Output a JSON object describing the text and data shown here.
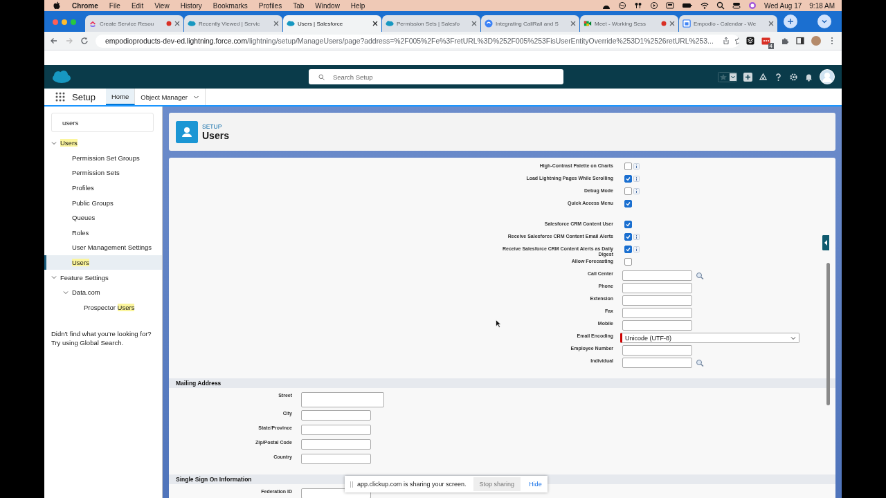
{
  "menu_bar": {
    "app": "Chrome",
    "items": [
      "File",
      "Edit",
      "View",
      "History",
      "Bookmarks",
      "Profiles",
      "Tab",
      "Window",
      "Help"
    ],
    "date": "Wed Aug 17",
    "time": "9:18 AM"
  },
  "tabs": [
    {
      "title": "Create Service Resou",
      "kind": "clickup",
      "recording": true,
      "selected": false
    },
    {
      "title": "Recently Viewed | Servic",
      "kind": "cloud",
      "recording": false,
      "selected": false
    },
    {
      "title": "Users | Salesforce",
      "kind": "cloud",
      "recording": false,
      "selected": true
    },
    {
      "title": "Permission Sets | Salesfo",
      "kind": "cloud",
      "recording": false,
      "selected": false
    },
    {
      "title": "Integrating CallRail and S",
      "kind": "callrail",
      "recording": false,
      "selected": false
    },
    {
      "title": "Meet - Working Sess",
      "kind": "meet",
      "recording": true,
      "selected": false
    },
    {
      "title": "Empodio - Calendar - We",
      "kind": "calendar",
      "recording": false,
      "selected": false
    }
  ],
  "address_bar": {
    "host": "empodioproducts-dev-ed.lightning.force.com",
    "path": "/lightning/setup/ManageUsers/page?address=%2F005%2Fe%3FretURL%3D%252F005%253FisUserEntityOverride%253D1%2526retURL%253...",
    "extension_badge": "4"
  },
  "header": {
    "search": {
      "placeholder": "Search Setup"
    }
  },
  "nav": {
    "app_name": "Setup",
    "tabs": [
      {
        "label": "Home",
        "selected": true,
        "dropdown": false
      },
      {
        "label": "Object Manager",
        "selected": false,
        "dropdown": true
      }
    ]
  },
  "sidebar": {
    "search": {
      "value": "users"
    },
    "tree": [
      {
        "segments": [
          {
            "text": "Users",
            "highlight": true
          }
        ],
        "expanded": true,
        "selected": false,
        "children": [
          {
            "segments": [
              {
                "text": "Permission Set Groups",
                "highlight": false
              }
            ],
            "selected": false
          },
          {
            "segments": [
              {
                "text": "Permission Sets",
                "highlight": false
              }
            ],
            "selected": false
          },
          {
            "segments": [
              {
                "text": "Profiles",
                "highlight": false
              }
            ],
            "selected": false
          },
          {
            "segments": [
              {
                "text": "Public Groups",
                "highlight": false
              }
            ],
            "selected": false
          },
          {
            "segments": [
              {
                "text": "Queues",
                "highlight": false
              }
            ],
            "selected": false
          },
          {
            "segments": [
              {
                "text": "Roles",
                "highlight": false
              }
            ],
            "selected": false
          },
          {
            "segments": [
              {
                "text": "User Management Settings",
                "highlight": false
              }
            ],
            "selected": false
          },
          {
            "segments": [
              {
                "text": "Users",
                "highlight": true
              }
            ],
            "selected": true
          }
        ]
      },
      {
        "segments": [
          {
            "text": "Feature Settings",
            "highlight": false
          }
        ],
        "expanded": true,
        "selected": false,
        "children": [
          {
            "segments": [
              {
                "text": "Data.com",
                "highlight": false
              }
            ],
            "expanded": true,
            "selected": false,
            "children": [
              {
                "segments": [
                  {
                    "text": "Prospector ",
                    "highlight": false
                  },
                  {
                    "text": "Users",
                    "highlight": true
                  }
                ],
                "selected": false
              }
            ]
          }
        ]
      }
    ],
    "footer": "Didn't find what you're looking for? Try using Global Search."
  },
  "page_header": {
    "eyebrow": "SETUP",
    "title": "Users"
  },
  "form": {
    "groups": [
      {
        "rows": [
          {
            "label": "High-Contrast Palette on Charts",
            "kind": "checkbox",
            "checked": false,
            "info": true
          },
          {
            "label": "Load Lightning Pages While Scrolling",
            "kind": "checkbox",
            "checked": true,
            "info": true
          },
          {
            "label": "Debug Mode",
            "kind": "checkbox",
            "checked": false,
            "info": true
          },
          {
            "label": "Quick Access Menu",
            "kind": "checkbox",
            "checked": true,
            "info": false
          }
        ]
      },
      {
        "rows": [
          {
            "label": "Salesforce CRM Content User",
            "kind": "checkbox",
            "checked": true,
            "info": false
          },
          {
            "label": "Receive Salesforce CRM Content Email Alerts",
            "kind": "checkbox",
            "checked": true,
            "info": true
          },
          {
            "label": "Receive Salesforce CRM Content Alerts as Daily Digest",
            "kind": "checkbox",
            "checked": true,
            "info": true
          },
          {
            "label": "Allow Forecasting",
            "kind": "checkbox",
            "checked": false,
            "info": false
          },
          {
            "label": "Call Center",
            "kind": "lookup"
          },
          {
            "label": "Phone",
            "kind": "text"
          },
          {
            "label": "Extension",
            "kind": "text"
          },
          {
            "label": "Fax",
            "kind": "text"
          },
          {
            "label": "Mobile",
            "kind": "text"
          },
          {
            "label": "Email Encoding",
            "kind": "select",
            "value": "Unicode (UTF-8)",
            "required": true
          },
          {
            "label": "Employee Number",
            "kind": "text"
          },
          {
            "label": "Individual",
            "kind": "lookup"
          }
        ]
      }
    ],
    "sections": [
      {
        "title": "Mailing Address",
        "rows": [
          {
            "label": "Street",
            "kind": "textarea"
          },
          {
            "label": "City",
            "kind": "text"
          },
          {
            "label": "State/Province",
            "kind": "text"
          },
          {
            "label": "Zip/Postal Code",
            "kind": "text"
          },
          {
            "label": "Country",
            "kind": "text"
          }
        ]
      },
      {
        "title": "Single Sign On Information",
        "rows": [
          {
            "label": "Federation ID",
            "kind": "text"
          }
        ]
      }
    ]
  },
  "share_bar": {
    "message": "app.clickup.com is sharing your screen.",
    "stop_button": "Stop sharing",
    "hide_link": "Hide"
  }
}
